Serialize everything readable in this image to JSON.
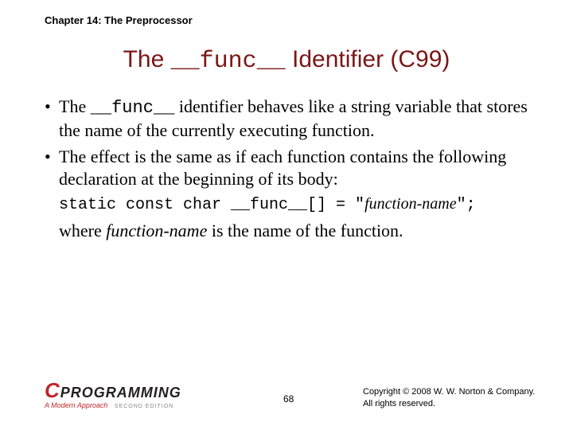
{
  "chapter": "Chapter 14: The Preprocessor",
  "title": {
    "pre": "The ",
    "code": "__func__",
    "post": " Identifier (C99)"
  },
  "bullets": [
    {
      "parts": [
        {
          "t": "The ",
          "mono": false
        },
        {
          "t": "__func__",
          "mono": true
        },
        {
          "t": " identifier behaves like a string variable that stores the name of the currently executing function.",
          "mono": false
        }
      ]
    },
    {
      "parts": [
        {
          "t": "The effect is the same as if each function contains the following declaration at the beginning of its body:",
          "mono": false
        }
      ]
    }
  ],
  "code": {
    "pre": "static const char __func__[] = \"",
    "ital": "function-name",
    "post": "\";"
  },
  "after": {
    "pre": "where ",
    "ital": "function-name",
    "post": " is the name of the function."
  },
  "logo": {
    "c": "C",
    "prog": "PROGRAMMING",
    "sub": "A Modern Approach",
    "ed": "SECOND EDITION"
  },
  "page": "68",
  "copyright": {
    "l1": "Copyright © 2008 W. W. Norton & Company.",
    "l2": "All rights reserved."
  }
}
